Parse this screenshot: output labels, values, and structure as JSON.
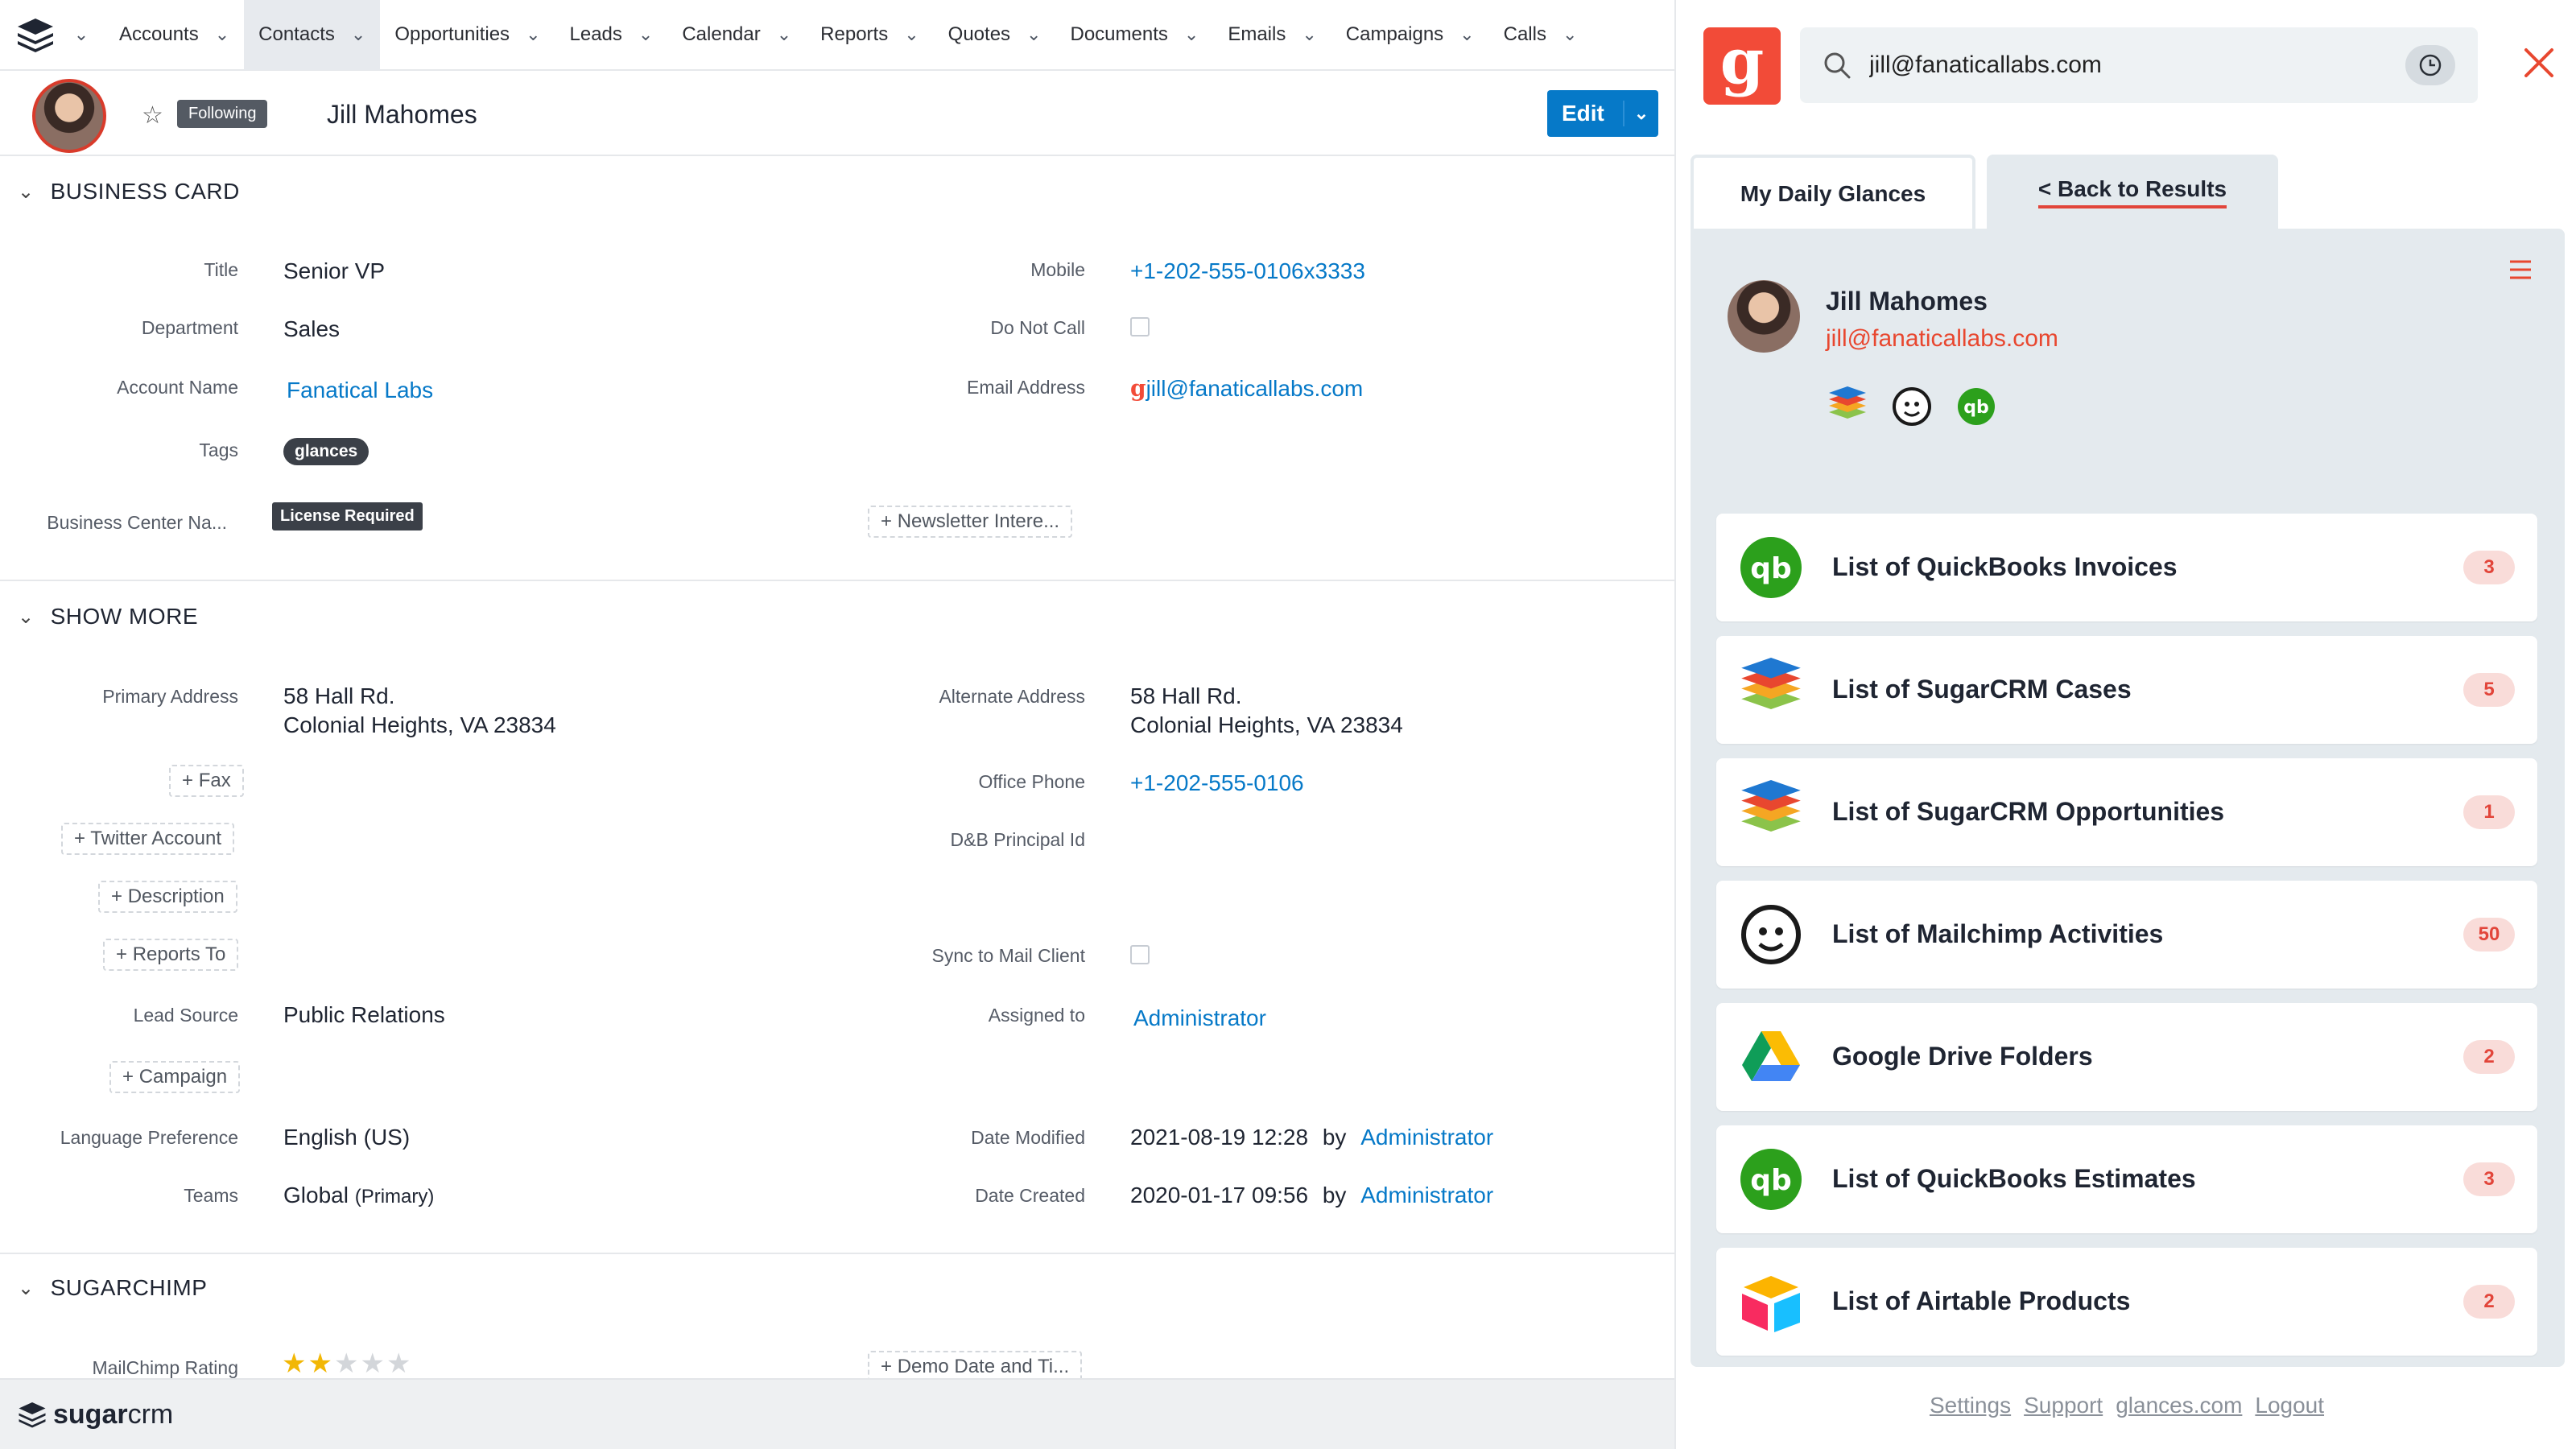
{
  "nav": {
    "tabs": [
      {
        "label": "Accounts"
      },
      {
        "label": "Contacts"
      },
      {
        "label": "Opportunities"
      },
      {
        "label": "Leads"
      },
      {
        "label": "Calendar"
      },
      {
        "label": "Reports"
      },
      {
        "label": "Quotes"
      },
      {
        "label": "Documents"
      },
      {
        "label": "Emails"
      },
      {
        "label": "Campaigns"
      },
      {
        "label": "Calls"
      }
    ],
    "active_tab": "Contacts"
  },
  "record": {
    "following_label": "Following",
    "name": "Jill Mahomes",
    "edit_label": "Edit"
  },
  "business_card": {
    "heading": "BUSINESS CARD",
    "title_label": "Title",
    "title_value": "Senior VP",
    "department_label": "Department",
    "department_value": "Sales",
    "account_label": "Account Name",
    "account_value": "Fanatical Labs",
    "tags_label": "Tags",
    "tag": "glances",
    "business_center_label": "Business Center Na...",
    "license_badge": "License Required",
    "mobile_label": "Mobile",
    "mobile_value": "+1-202-555-0106x3333",
    "dnc_label": "Do Not Call",
    "email_label": "Email Address",
    "email_value": "jill@fanaticallabs.com",
    "newsletter_button": "Newsletter Intere..."
  },
  "show_more": {
    "heading": "SHOW MORE",
    "primary_address_label": "Primary Address",
    "primary_address_line1": "58 Hall Rd.",
    "primary_address_line2": "Colonial Heights, VA 23834",
    "alternate_address_label": "Alternate Address",
    "alternate_address_line1": "58 Hall Rd.",
    "alternate_address_line2": "Colonial Heights, VA 23834",
    "fax_button": "Fax",
    "office_phone_label": "Office Phone",
    "office_phone_value": "+1-202-555-0106",
    "twitter_button": "Twitter Account",
    "dnb_label": "D&B Principal Id",
    "description_button": "Description",
    "reports_to_button": "Reports To",
    "sync_label": "Sync to Mail Client",
    "lead_source_label": "Lead Source",
    "lead_source_value": "Public Relations",
    "assigned_label": "Assigned to",
    "assigned_value": "Administrator",
    "campaign_button": "Campaign",
    "language_label": "Language Preference",
    "language_value": "English (US)",
    "modified_label": "Date Modified",
    "modified_value": "2021-08-19 12:28",
    "modified_by": "by",
    "modified_user": "Administrator",
    "teams_label": "Teams",
    "teams_value": "Global",
    "teams_primary": "(Primary)",
    "created_label": "Date Created",
    "created_value": "2020-01-17 09:56",
    "created_by": "by",
    "created_user": "Administrator"
  },
  "sugarchimp": {
    "heading": "SUGARCHIMP",
    "rating_label": "MailChimp Rating",
    "rating": 2,
    "rating_max": 5,
    "demo_button": "Demo Date and Ti..."
  },
  "footer": {
    "brand_bold": "sugar",
    "brand_light": "crm"
  },
  "glances": {
    "logo_letter": "g",
    "search_value": "jill@fanaticallabs.com",
    "tab_daily": "My Daily Glances",
    "tab_back": "< Back to Results",
    "contact_name": "Jill Mahomes",
    "contact_email": "jill@fanaticallabs.com",
    "cards": [
      {
        "title": "List of QuickBooks Invoices",
        "count": "3",
        "icon": "quickbooks-icon"
      },
      {
        "title": "List of SugarCRM Cases",
        "count": "5",
        "icon": "sugarcrm-icon"
      },
      {
        "title": "List of SugarCRM Opportunities",
        "count": "1",
        "icon": "sugarcrm-icon"
      },
      {
        "title": "List of Mailchimp Activities",
        "count": "50",
        "icon": "mailchimp-icon"
      },
      {
        "title": "Google Drive Folders",
        "count": "2",
        "icon": "google-drive-icon"
      },
      {
        "title": "List of QuickBooks Estimates",
        "count": "3",
        "icon": "quickbooks-icon"
      },
      {
        "title": "List of Airtable Products",
        "count": "2",
        "icon": "airtable-icon"
      }
    ],
    "footer_links": [
      "Settings",
      "Support",
      "glances.com",
      "Logout"
    ],
    "colors": {
      "brand": "#f24b38",
      "badge_bg": "#f9dcd9",
      "badge_text": "#e2453a"
    }
  }
}
